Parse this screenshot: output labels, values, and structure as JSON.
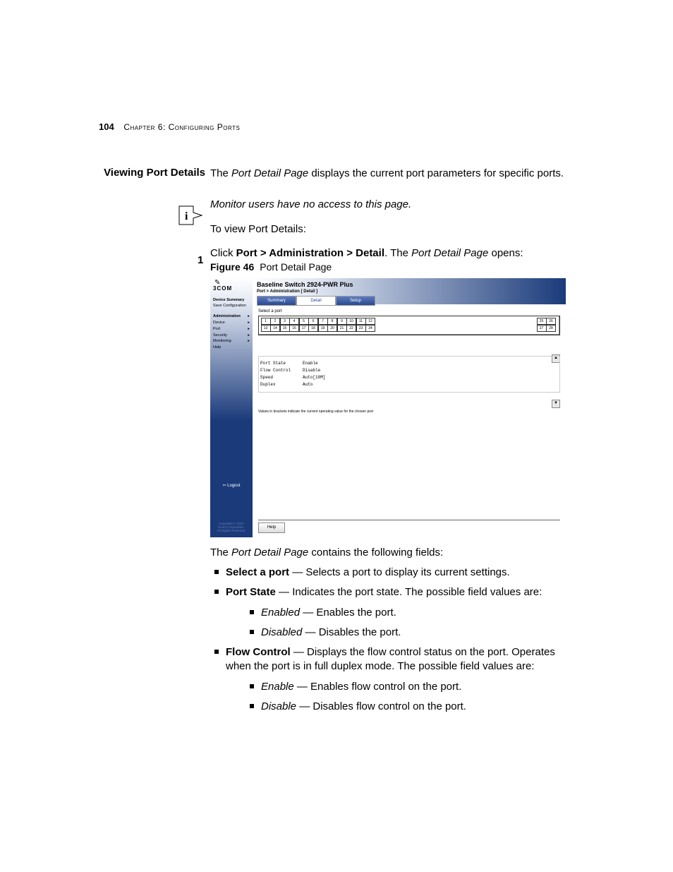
{
  "header": {
    "page_number": "104",
    "chapter": "Chapter 6: Configuring Ports"
  },
  "sidebar_heading": "Viewing Port Details",
  "intro": {
    "pre": "The ",
    "em": "Port Detail Page",
    "post": " displays the current port parameters for specific ports."
  },
  "note": "Monitor users have no access to this page.",
  "lead_in": "To view Port Details:",
  "step": {
    "num": "1",
    "pre": "Click ",
    "bold": "Port > Administration > Detail",
    "mid": ". The ",
    "em": "Port Detail Page",
    "post": " opens:"
  },
  "figure": {
    "label": "Figure 46",
    "caption": "Port Detail Page"
  },
  "screenshot": {
    "logo": "3COM",
    "nav": {
      "device_summary": "Device Summary",
      "save_config": "Save Configuration",
      "items": [
        "Administration",
        "Device",
        "Port",
        "Security",
        "Monitoring",
        "Help"
      ]
    },
    "logout": "Logout",
    "copyright": "Copyright © 2007\n3Com Corporation.\nAll Rights Reserved.",
    "title": "Baseline Switch 2924-PWR Plus",
    "breadcrumb": "Port > Administration [ Detail ]",
    "tabs": {
      "summary": "Summary",
      "detail": "Detail",
      "setup": "Setup"
    },
    "select_label": "Select a port",
    "ports_top": [
      "1",
      "2",
      "3",
      "4",
      "5",
      "6",
      "7",
      "8",
      "9",
      "10",
      "11",
      "12"
    ],
    "ports_bottom": [
      "13",
      "14",
      "15",
      "16",
      "17",
      "18",
      "19",
      "20",
      "21",
      "22",
      "23",
      "24"
    ],
    "ports_right_top": [
      "25",
      "26"
    ],
    "ports_right_bottom": [
      "27",
      "28"
    ],
    "details": {
      "port_state_k": "Port State",
      "port_state_v": "Enable",
      "flow_k": "Flow Control",
      "flow_v": "Disable",
      "speed_k": "Speed",
      "speed_v": "Auto[10M]",
      "duplex_k": "Duplex",
      "duplex_v": "Auto"
    },
    "footnote": "Values in brackets indicate the current operating value for the chosen port",
    "help": "Help"
  },
  "after_fig": {
    "pre": "The ",
    "em": "Port Detail Page",
    "post": " contains the following fields:"
  },
  "bullets": {
    "b1": {
      "term": "Select a port",
      "desc": " — Selects a port to display its current settings."
    },
    "b2": {
      "term": "Port State",
      "desc": " — Indicates the port state. The possible field values are:",
      "sub": [
        {
          "em": "Enabled",
          "desc": " — Enables the port."
        },
        {
          "em": "Disabled",
          "desc": " — Disables the port."
        }
      ]
    },
    "b3": {
      "term": "Flow Control",
      "desc": " — Displays the flow control status on the port. Operates when the port is in full duplex mode. The possible field values are:",
      "sub": [
        {
          "em": "Enable",
          "desc": " — Enables flow control on the port."
        },
        {
          "em": "Disable",
          "desc": " — Disables flow control on the port."
        }
      ]
    }
  }
}
